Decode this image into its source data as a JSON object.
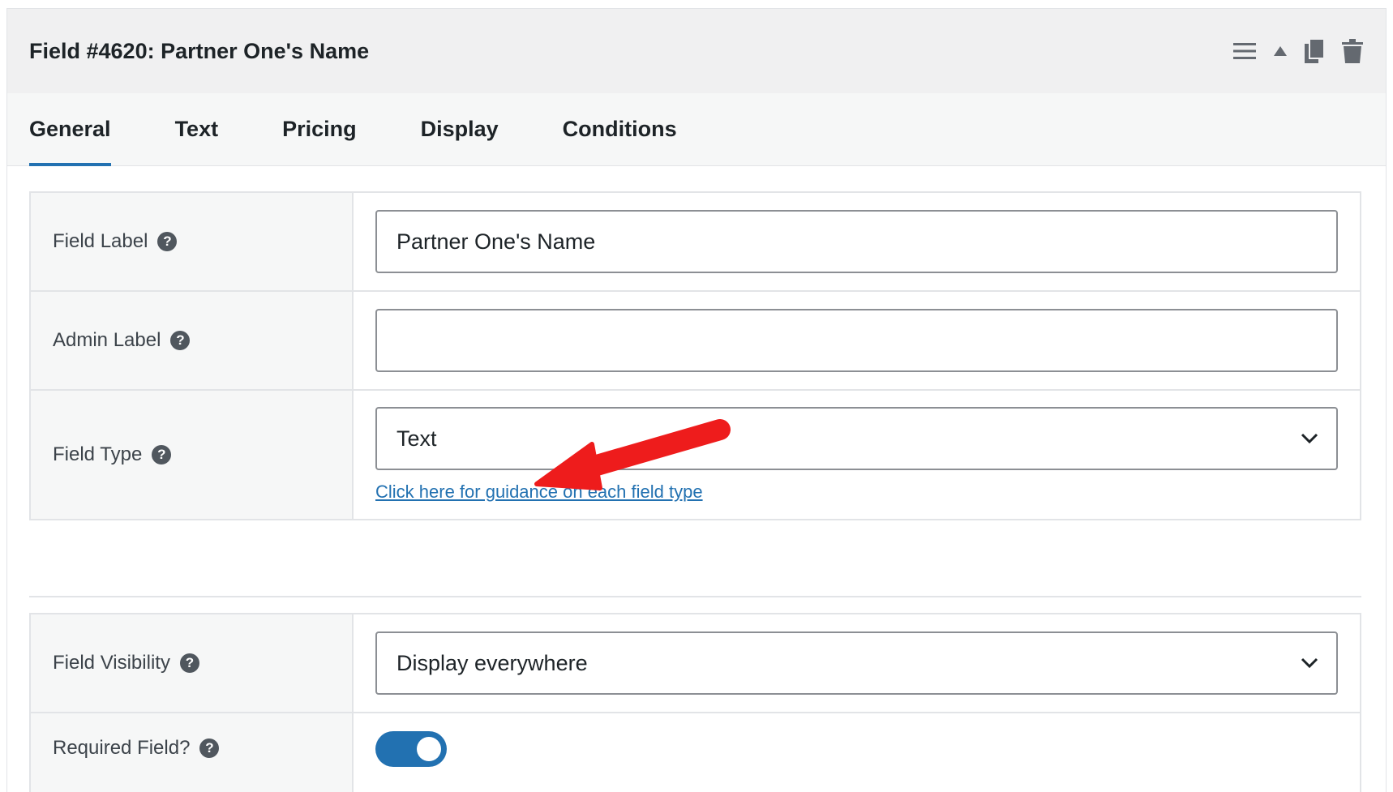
{
  "header": {
    "title": "Field #4620: Partner One's Name",
    "icons": [
      "menu-lines-icon",
      "collapse-triangle-icon",
      "duplicate-icon",
      "trash-icon"
    ]
  },
  "tabs": [
    {
      "label": "General",
      "active": true
    },
    {
      "label": "Text",
      "active": false
    },
    {
      "label": "Pricing",
      "active": false
    },
    {
      "label": "Display",
      "active": false
    },
    {
      "label": "Conditions",
      "active": false
    }
  ],
  "form": {
    "field_label": {
      "label": "Field Label",
      "value": "Partner One's Name"
    },
    "admin_label": {
      "label": "Admin Label",
      "value": ""
    },
    "field_type": {
      "label": "Field Type",
      "value": "Text",
      "link": "Click here for guidance on each field type"
    },
    "field_visibility": {
      "label": "Field Visibility",
      "value": "Display everywhere"
    },
    "required_field": {
      "label": "Required Field?",
      "enabled": true
    }
  },
  "help_glyph": "?",
  "colors": {
    "accent": "#2271b1",
    "annotation_arrow": "#ee1c1c"
  }
}
